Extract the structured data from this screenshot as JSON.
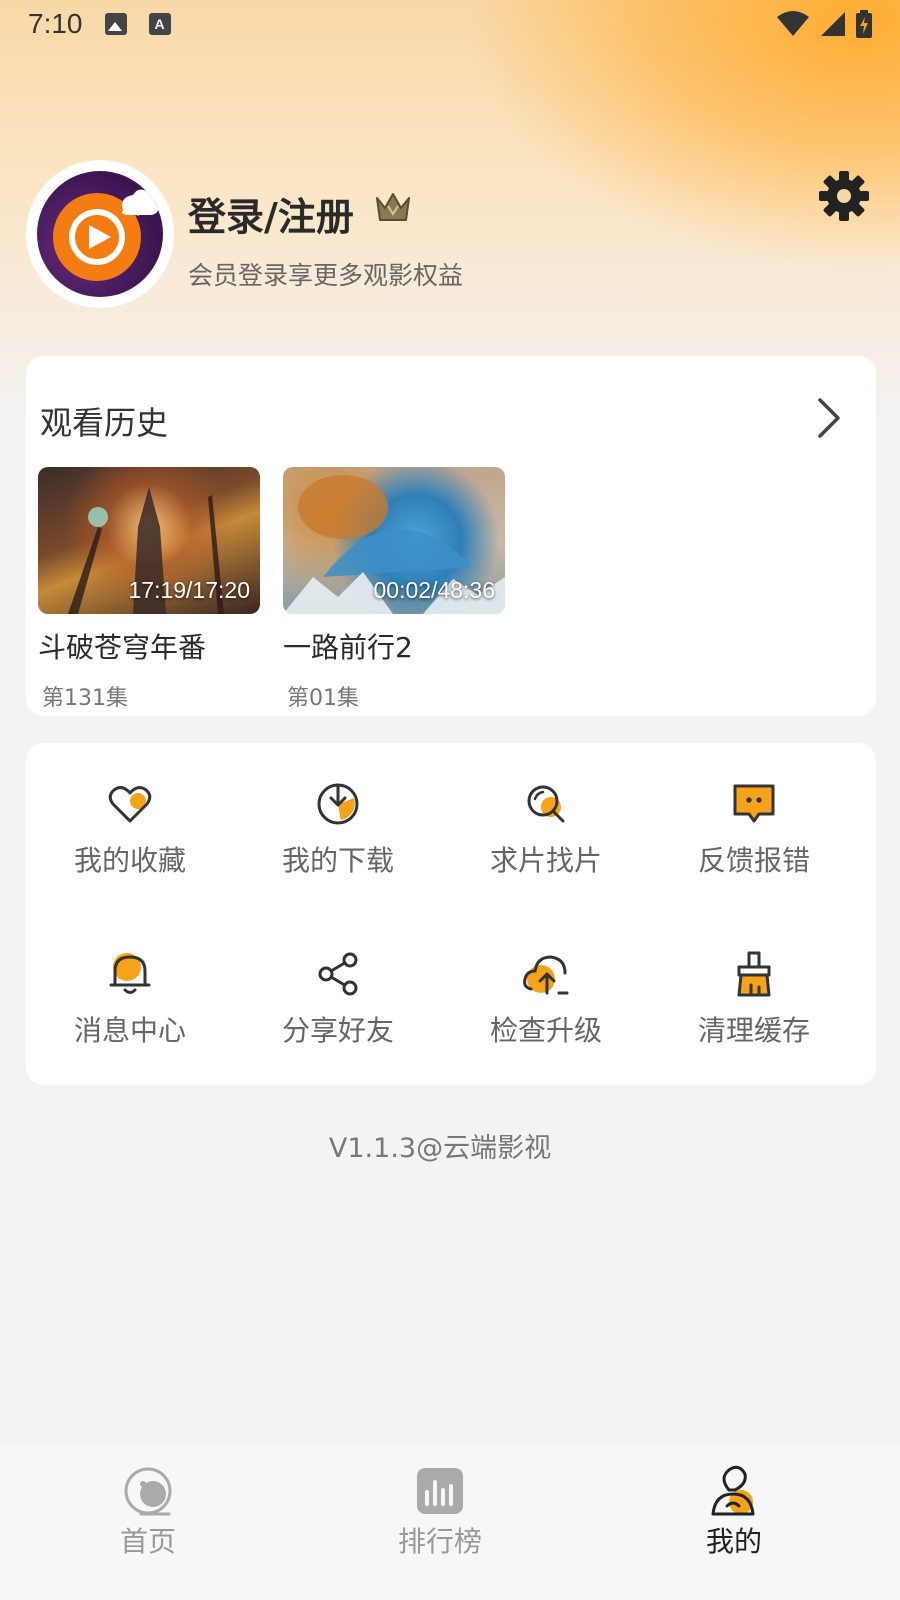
{
  "status_bar": {
    "time": "7:10",
    "icons": [
      "image-icon",
      "text-a-icon",
      "wifi-icon",
      "signal-icon",
      "battery-icon"
    ]
  },
  "profile": {
    "title": "登录/注册",
    "subtitle": "会员登录享更多观影权益",
    "icons": [
      "avatar-logo",
      "crown-icon",
      "gear-icon"
    ]
  },
  "history": {
    "title": "观看历史",
    "items": [
      {
        "title": "斗破苍穹年番",
        "episode": "第131集",
        "progress": "17:19/17:20"
      },
      {
        "title": "一路前行2",
        "episode": "第01集",
        "progress": "00:02/48:36"
      }
    ]
  },
  "menu": {
    "items": [
      {
        "label": "我的收藏",
        "icon": "heart-icon"
      },
      {
        "label": "我的下载",
        "icon": "download-icon"
      },
      {
        "label": "求片找片",
        "icon": "search-icon"
      },
      {
        "label": "反馈报错",
        "icon": "feedback-icon"
      },
      {
        "label": "消息中心",
        "icon": "bell-icon"
      },
      {
        "label": "分享好友",
        "icon": "share-icon"
      },
      {
        "label": "检查升级",
        "icon": "cloud-upload-icon"
      },
      {
        "label": "清理缓存",
        "icon": "broom-icon"
      }
    ]
  },
  "version": "V1.1.3@云端影视",
  "nav": {
    "items": [
      {
        "label": "首页",
        "icon": "home-icon",
        "active": false
      },
      {
        "label": "排行榜",
        "icon": "chart-icon",
        "active": false
      },
      {
        "label": "我的",
        "icon": "profile-icon",
        "active": true
      }
    ]
  },
  "colors": {
    "accent": "#f7a21b",
    "icon_outline": "#333333",
    "inactive": "#999999"
  }
}
